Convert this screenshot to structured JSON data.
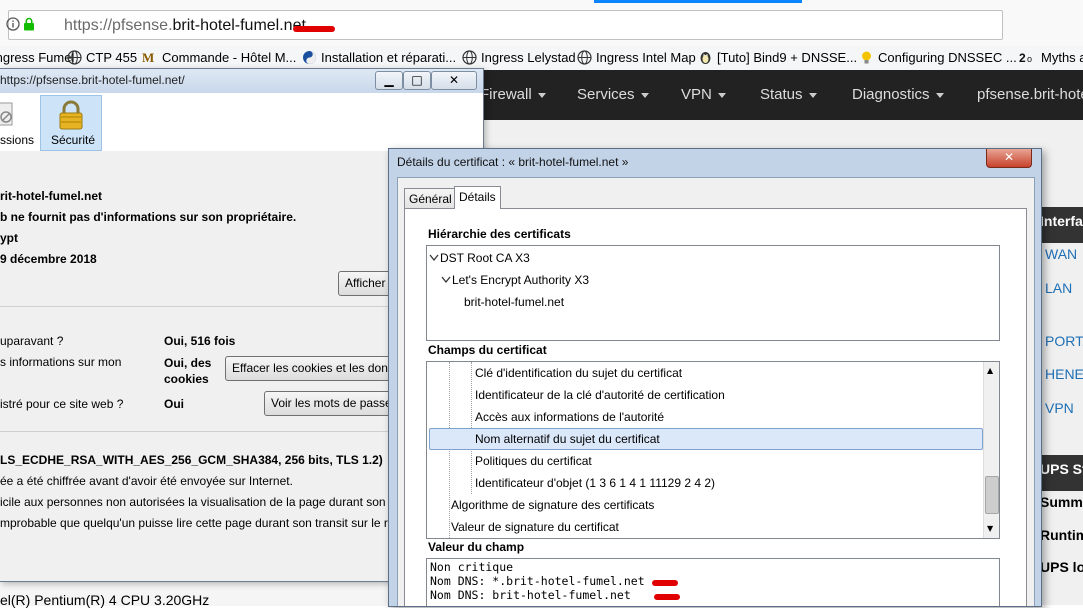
{
  "browser": {
    "url_prefix": "https://pfsense.",
    "url_domain": "brit-hotel-fumel.net",
    "bookmarks": [
      {
        "label": "Ingress Fumel",
        "icon": "globe-icon"
      },
      {
        "label": "CTP 455",
        "icon": "globe-icon"
      },
      {
        "label": "Commande - Hôtel M...",
        "icon": "m-logo-icon"
      },
      {
        "label": "Installation et réparati...",
        "icon": "yin-yang-icon"
      },
      {
        "label": "Ingress Lelystad",
        "icon": "globe-icon"
      },
      {
        "label": "Ingress Intel Map",
        "icon": "globe-icon"
      },
      {
        "label": "[Tuto] Bind9 + DNSSE...",
        "icon": "penguin-icon"
      },
      {
        "label": "Configuring DNSSEC ...",
        "icon": "lightbulb-icon"
      },
      {
        "label": "Myths a",
        "icon": "brand-2g-icon"
      }
    ]
  },
  "pfsense": {
    "menu": [
      "Firewall",
      "Services",
      "VPN",
      "Status",
      "Diagnostics",
      "pfsense.brit-hote"
    ],
    "panel_interfaces": "Interfa",
    "links": [
      "WAN",
      "LAN",
      "PORTA",
      "HENE",
      "VPN"
    ],
    "panel_ups": "UPS St",
    "ups_rows": [
      "Summary",
      "Runtime",
      "UPS load"
    ],
    "cpu_text": "el(R) Pentium(R) 4 CPU 3.20GHz"
  },
  "page_info": {
    "title": "https://pfsense.brit-hotel-fumel.net/",
    "tabs": {
      "permissions": "ssions",
      "security": "Sécurité"
    },
    "site": "rit-hotel-fumel.net",
    "owner_text": "b ne fournit pas d'informations sur son propriétaire.",
    "verified_by": "ypt",
    "expires": "9 décembre 2018",
    "btn_view_cert": "Afficher",
    "q_visited": "uparavant ?",
    "a_visited": "Oui, 516 fois",
    "q_storing": "s informations sur mon",
    "a_storing": "Oui, des cookies",
    "btn_clear_cookies": "Effacer les cookies et les donn",
    "q_passwords": "istré pour ce site web ?",
    "a_passwords": "Oui",
    "btn_view_passwords": "Voir les mots de passe",
    "cipher": "LS_ECDHE_RSA_WITH_AES_256_GCM_SHA384, 256 bits, TLS 1.2)",
    "encrypted_text": "ée a été chiffrée avant d'avoir été envoyée sur Internet.",
    "line_a": "icile aux personnes non autorisées la visualisation de la page durant son tr",
    "line_b": "mprobable que quelqu'un puisse lire cette page durant son transit sur le r"
  },
  "cert": {
    "title": "Détails du certificat : « brit-hotel-fumel.net »",
    "tab_general": "Général",
    "tab_details": "Détails",
    "hierarchy_label": "Hiérarchie des certificats",
    "hierarchy": [
      "DST Root CA X3",
      "Let's Encrypt Authority X3",
      "brit-hotel-fumel.net"
    ],
    "fields_label": "Champs du certificat",
    "fields": [
      "Clé d'identification du sujet du certificat",
      "Identificateur de la clé d'autorité de certification",
      "Accès aux informations de l'autorité",
      "Nom alternatif du sujet du certificat",
      "Politiques du certificat",
      "Identificateur d'objet (1 3 6 1 4 1 11129 2 4 2)",
      "Algorithme de signature des certificats",
      "Valeur de signature du certificat"
    ],
    "value_label": "Valeur du champ",
    "value_lines": [
      "Non critique",
      "Nom DNS: *.brit-hotel-fumel.net",
      "Nom DNS: brit-hotel-fumel.net"
    ]
  },
  "colors": {
    "pfsense_nav": "#222222",
    "link": "#1e6fb5",
    "selection": "#dbe8f9",
    "redaction": "#e00000"
  }
}
